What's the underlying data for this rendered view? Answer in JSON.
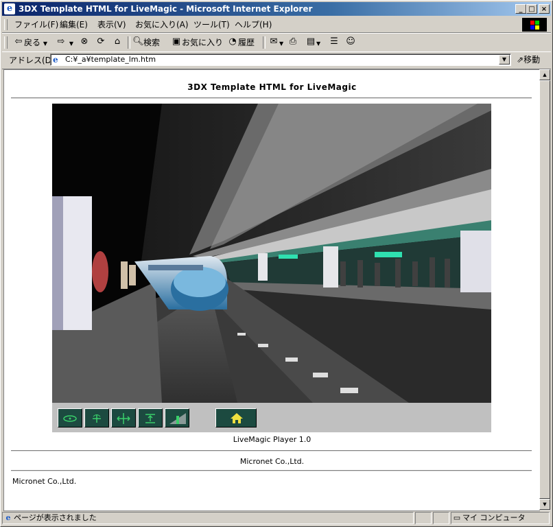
{
  "window": {
    "title": "3DX Template HTML for LiveMagic - Microsoft Internet Explorer",
    "minimize": "_",
    "maximize": "□",
    "close": "×"
  },
  "menu": [
    "ファイル(F)",
    "編集(E)",
    "表示(V)",
    "お気に入り(A)",
    "ツール(T)",
    "ヘルプ(H)"
  ],
  "toolbar": {
    "back": "戻る",
    "search": "検索",
    "favorites": "お気に入り",
    "history": "履歴"
  },
  "address": {
    "label": "アドレス(D)",
    "value": "C:¥_a¥template_lm.htm",
    "go": "移動"
  },
  "page": {
    "title": "3DX Template HTML for LiveMagic",
    "caption": "LiveMagic Player 1.0",
    "company": "Micronet Co.,Ltd.",
    "footer": "Micronet Co.,Ltd."
  },
  "controls": [
    "eye-icon",
    "rotate-icon",
    "move-icon",
    "elevate-icon",
    "speed-icon",
    "home-icon"
  ],
  "status": {
    "text": "ページが表示されました",
    "zone": "マイ コンピュータ"
  },
  "colors": {
    "titlebar_start": "#0a246a",
    "control_button": "#1c4a40",
    "control_icon": "#3ad06a"
  }
}
